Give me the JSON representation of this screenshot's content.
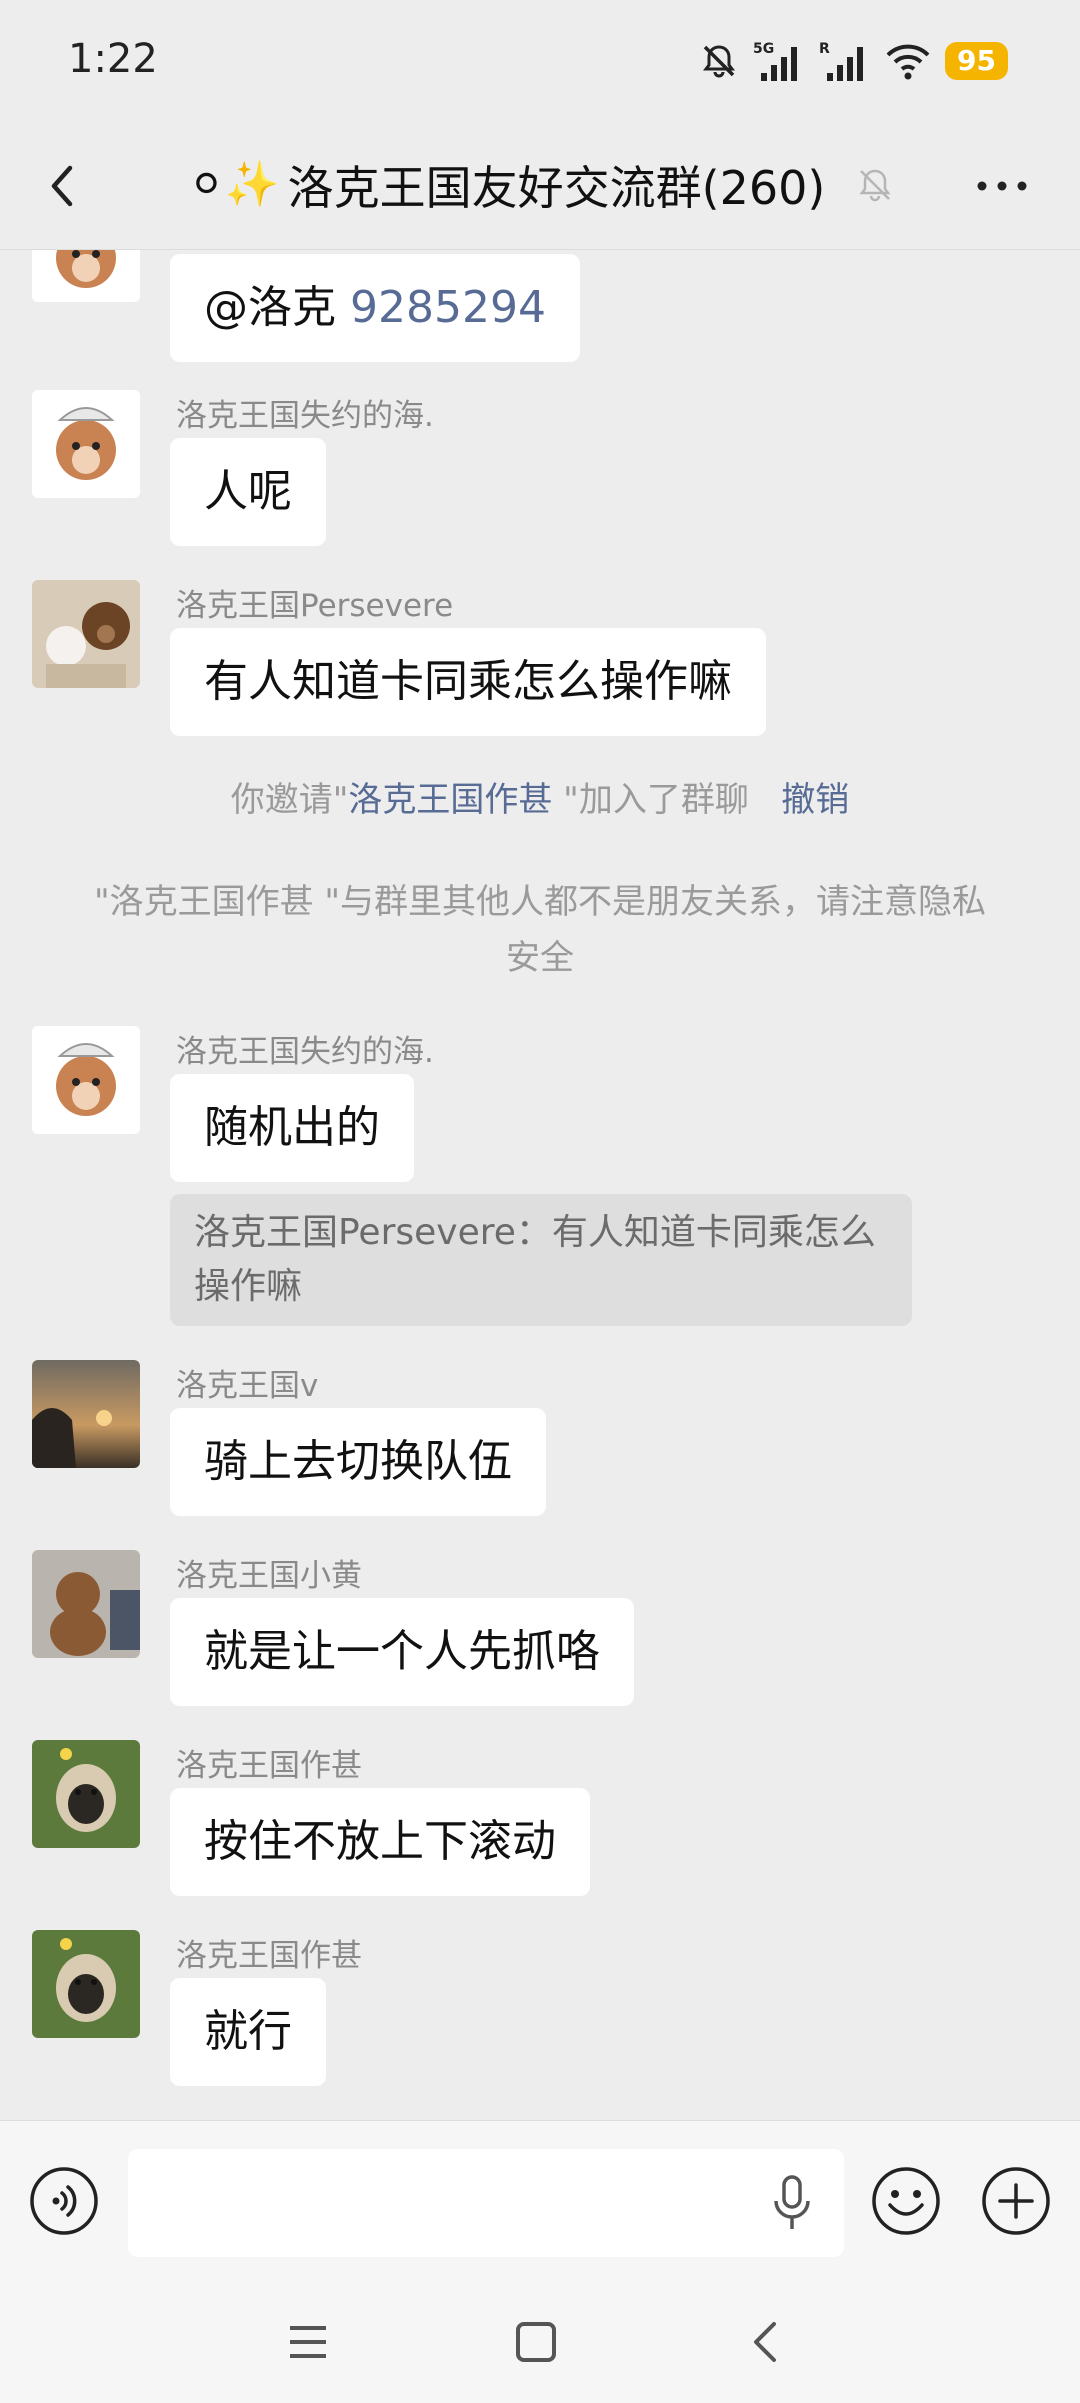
{
  "status_bar": {
    "time": "1:22",
    "network_5g": "5G",
    "network_r": "R",
    "battery": "95"
  },
  "header": {
    "title_emoji": "⚪✨",
    "title": "洛克王国友好交流群(260)"
  },
  "messages": [
    {
      "mention": "@洛克",
      "mention_num": "9285294"
    },
    {
      "sender": "洛克王国失约的海.",
      "text": "人呢"
    },
    {
      "sender": "洛克王国Persevere",
      "text": "有人知道卡同乘怎么操作嘛"
    },
    {
      "sender": "洛克王国失约的海.",
      "text": "随机出的",
      "quote": "洛克王国Persevere：有人知道卡同乘怎么操作嘛"
    },
    {
      "sender": "洛克王国v",
      "text": "骑上去切换队伍"
    },
    {
      "sender": "洛克王国小黄",
      "text": "就是让一个人先抓咯"
    },
    {
      "sender": "洛克王国作甚",
      "text": "按住不放上下滚动"
    },
    {
      "sender": "洛克王国作甚",
      "text": "就行"
    }
  ],
  "system": {
    "invite_prefix": "你邀请\"",
    "invite_name": "洛克王国作甚",
    "invite_suffix": " \"加入了群聊",
    "undo": "撤销",
    "privacy_notice": "\"洛克王国作甚 \"与群里其他人都不是朋友关系，请注意隐私安全"
  },
  "icons": {
    "back": "chevron-left-icon",
    "mute": "bell-off-icon",
    "more": "more-dots-icon",
    "voice": "voice-mode-icon",
    "mic": "microphone-icon",
    "emoji": "emoji-icon",
    "plus": "plus-icon"
  },
  "colors": {
    "background": "#ededed",
    "link": "#576b95",
    "battery": "#f5b400",
    "bubble": "#ffffff",
    "quote": "#dedede"
  }
}
